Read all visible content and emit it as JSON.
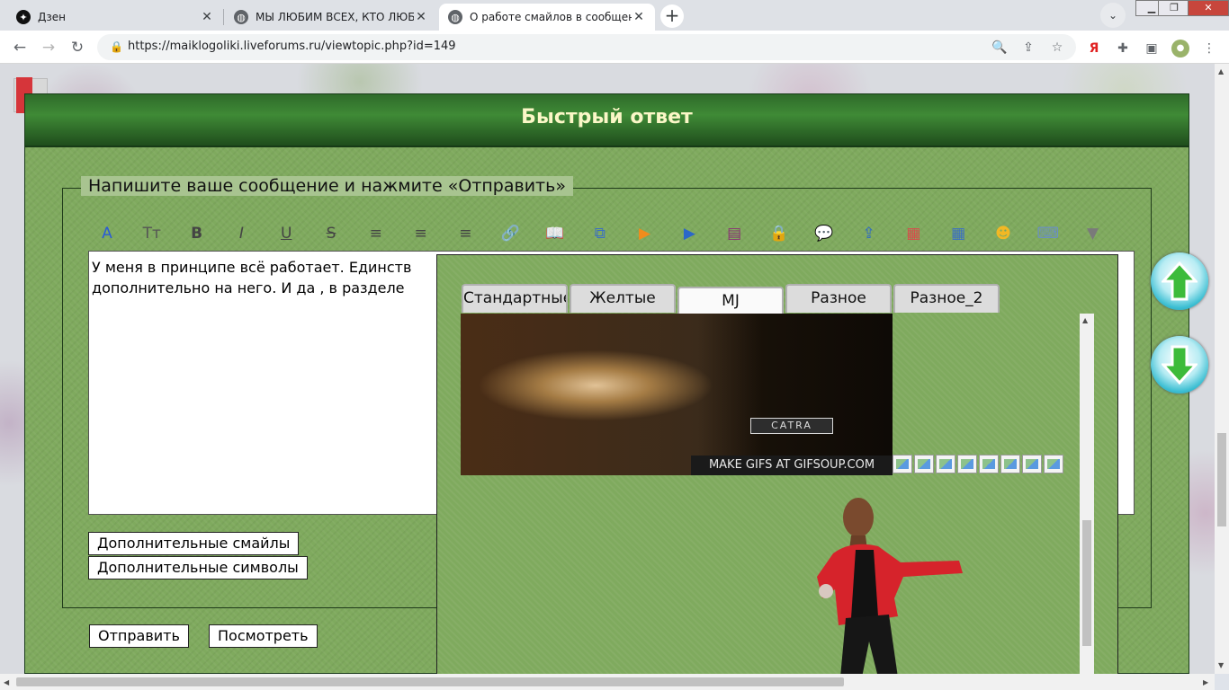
{
  "browser": {
    "tabs": [
      {
        "title": "Дзен",
        "icon": "dzen-icon"
      },
      {
        "title": "МЫ ЛЮБИМ ВСЕХ, КТО ЛЮБИТ",
        "icon": "globe-icon"
      },
      {
        "title": "О работе смайлов в сообщени",
        "icon": "globe-icon"
      }
    ],
    "url": "https://maiklogoliki.liveforums.ru/viewtopic.php?id=149",
    "close_glyph": "✕"
  },
  "quick_reply": {
    "heading": "Быстрый ответ",
    "legend": "Напишите ваше сообщение и нажмите «Отправить»",
    "message_line1": "У меня в принципе всё работает. Единств",
    "message_line2": "дополнительно на него. И да , в разделе",
    "extra_smileys_label": "Дополнительные смайлы",
    "extra_symbols_label": "Дополнительные символы",
    "send_label": "Отправить",
    "preview_label": "Посмотреть"
  },
  "editor_tools": [
    {
      "name": "font-icon",
      "glyph": "A",
      "color": "#2a5bd7"
    },
    {
      "name": "font-size-icon",
      "glyph": "Tт",
      "color": "#555555"
    },
    {
      "name": "bold-icon",
      "glyph": "B",
      "color": "#444444"
    },
    {
      "name": "italic-icon",
      "glyph": "I",
      "color": "#444444"
    },
    {
      "name": "underline-icon",
      "glyph": "U",
      "color": "#444444"
    },
    {
      "name": "strikethrough-icon",
      "glyph": "S",
      "color": "#444444"
    },
    {
      "name": "align-left-icon",
      "glyph": "≡",
      "color": "#444444"
    },
    {
      "name": "align-center-icon",
      "glyph": "≡",
      "color": "#444444"
    },
    {
      "name": "align-right-icon",
      "glyph": "≡",
      "color": "#444444"
    },
    {
      "name": "link-icon",
      "glyph": "🔗",
      "color": "#555555"
    },
    {
      "name": "book-icon",
      "glyph": "📖",
      "color": "#3a6fc4"
    },
    {
      "name": "copy-icon",
      "glyph": "⧉",
      "color": "#3a6fc4"
    },
    {
      "name": "play-orange-icon",
      "glyph": "▶",
      "color": "#f08c1c"
    },
    {
      "name": "play-blue-icon",
      "glyph": "▶",
      "color": "#2b67c9"
    },
    {
      "name": "archive-icon",
      "glyph": "▤",
      "color": "#8a2f74"
    },
    {
      "name": "lock-icon",
      "glyph": "🔒",
      "color": "#d99a1c"
    },
    {
      "name": "speech-bubble-icon",
      "glyph": "💬",
      "color": "#3a8fd4"
    },
    {
      "name": "upload-icon",
      "glyph": "⇪",
      "color": "#2b67c9"
    },
    {
      "name": "color-palette-icon",
      "glyph": "▦",
      "color": "#d84b4b"
    },
    {
      "name": "table-icon",
      "glyph": "▦",
      "color": "#3a6fc4"
    },
    {
      "name": "smiley-icon",
      "glyph": "☻",
      "color": "#f2b824"
    },
    {
      "name": "keyboard-icon",
      "glyph": "⌨",
      "color": "#6a8fc4"
    },
    {
      "name": "more-arrow-icon",
      "glyph": "▼",
      "color": "#7a7a7a"
    }
  ],
  "smiley_popup": {
    "tabs": [
      "Стандартные",
      "Желтые",
      "MJ",
      "Разное",
      "Разное_2"
    ],
    "active_tab": "MJ",
    "gif_caption": "MAKE GIFS AT GIFSOUP.COM",
    "gif_logo": "CATRA"
  }
}
